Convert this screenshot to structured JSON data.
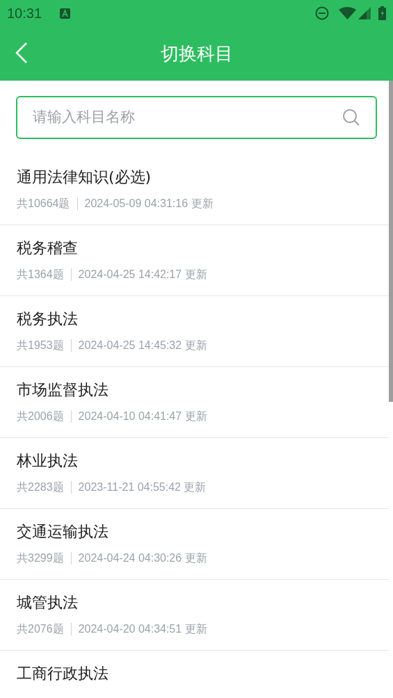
{
  "status_bar": {
    "time": "10:31"
  },
  "header": {
    "title": "切换科目"
  },
  "search": {
    "placeholder": "请输入科目名称"
  },
  "subjects": [
    {
      "name": "通用法律知识(必选)",
      "count": "共10664题",
      "updated": "2024-05-09 04:31:16 更新"
    },
    {
      "name": "税务稽查",
      "count": "共1364题",
      "updated": "2024-04-25 14:42:17 更新"
    },
    {
      "name": "税务执法",
      "count": "共1953题",
      "updated": "2024-04-25 14:45:32 更新"
    },
    {
      "name": "市场监督执法",
      "count": "共2006题",
      "updated": "2024-04-10 04:41:47 更新"
    },
    {
      "name": "林业执法",
      "count": "共2283题",
      "updated": "2023-11-21 04:55:42 更新"
    },
    {
      "name": "交通运输执法",
      "count": "共3299题",
      "updated": "2024-04-24 04:30:26 更新"
    },
    {
      "name": "城管执法",
      "count": "共2076题",
      "updated": "2024-04-20 04:34:51 更新"
    },
    {
      "name": "工商行政执法"
    }
  ]
}
